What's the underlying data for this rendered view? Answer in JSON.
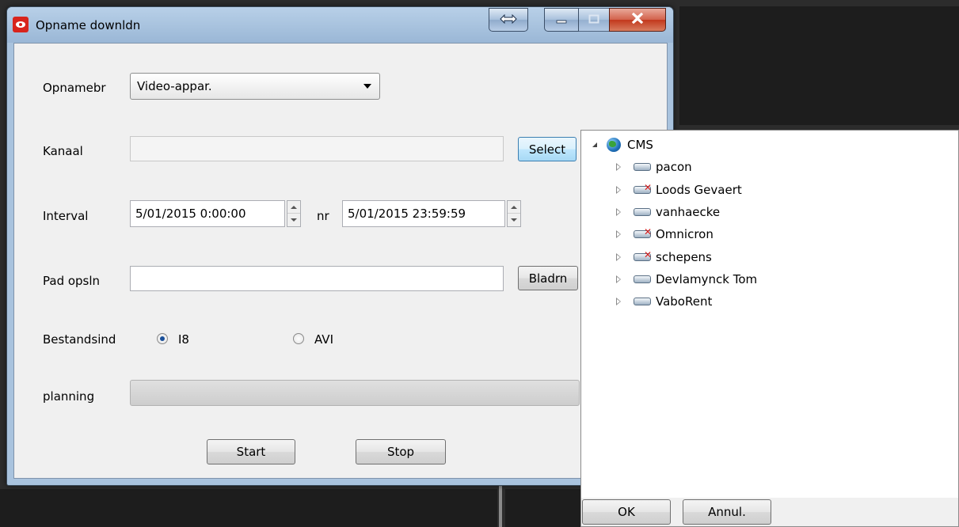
{
  "window": {
    "title": "Opname downldn"
  },
  "form": {
    "source_label": "Opnamebr",
    "source_value": "Video-appar.",
    "channel_label": "Kanaal",
    "channel_value": "",
    "select_button": "Select",
    "interval_label": "Interval",
    "interval_from": "5/01/2015 0:00:00",
    "interval_separator": "nr",
    "interval_to": "5/01/2015 23:59:59",
    "path_label": "Pad opsln",
    "path_value": "",
    "browse_button": "Bladrn",
    "format_label": "Bestandsind",
    "format_options": [
      {
        "label": "I8",
        "selected": true
      },
      {
        "label": "AVI",
        "selected": false
      }
    ],
    "planning_label": "planning",
    "planning_progress": 0,
    "start_button": "Start",
    "stop_button": "Stop"
  },
  "tree": {
    "root": {
      "label": "CMS",
      "icon": "globe-icon",
      "expanded": true
    },
    "items": [
      {
        "label": "pacon",
        "status": "online"
      },
      {
        "label": "Loods Gevaert",
        "status": "offline"
      },
      {
        "label": "vanhaecke",
        "status": "online"
      },
      {
        "label": "Omnicron",
        "status": "offline"
      },
      {
        "label": "schepens",
        "status": "offline"
      },
      {
        "label": "Devlamynck Tom",
        "status": "online"
      },
      {
        "label": "VaboRent",
        "status": "online"
      }
    ],
    "ok_button": "OK",
    "cancel_button": "Annul."
  },
  "colors": {
    "offline_badge": "#d42020",
    "titlebar": "#a9c3de",
    "close_button": "#c2381c"
  }
}
